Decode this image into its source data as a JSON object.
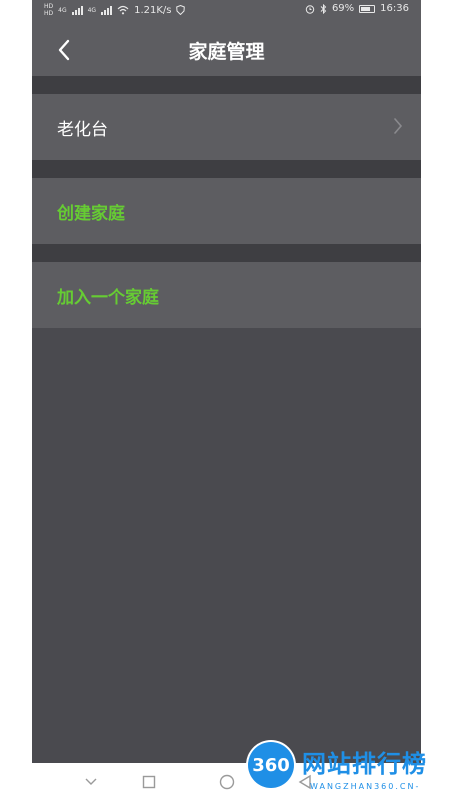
{
  "statusbar": {
    "hd_top": "HD",
    "hd_bottom": "HD",
    "net1": "4G",
    "net2": "4G",
    "speed": "1.21K/s",
    "battery_pct": "69%",
    "time": "16:36"
  },
  "header": {
    "title": "家庭管理",
    "back_icon": "chevron-left-icon"
  },
  "list": {
    "items": [
      {
        "label": "老化台",
        "color": "#ffffff",
        "has_chevron": true
      },
      {
        "label": "创建家庭",
        "color": "#66cc33"
      },
      {
        "label": "加入一个家庭",
        "color": "#66cc33"
      }
    ]
  },
  "navbar": {
    "icons": [
      "chevron-down-icon",
      "square-icon",
      "circle-icon",
      "triangle-back-icon"
    ]
  },
  "watermark": {
    "badge": "360",
    "cn": "网站排行榜",
    "en": "WANGZHAN360.CN-"
  },
  "colors": {
    "accent": "#66cc33",
    "panel": "#5d5d61",
    "background": "#4a4a4f"
  }
}
